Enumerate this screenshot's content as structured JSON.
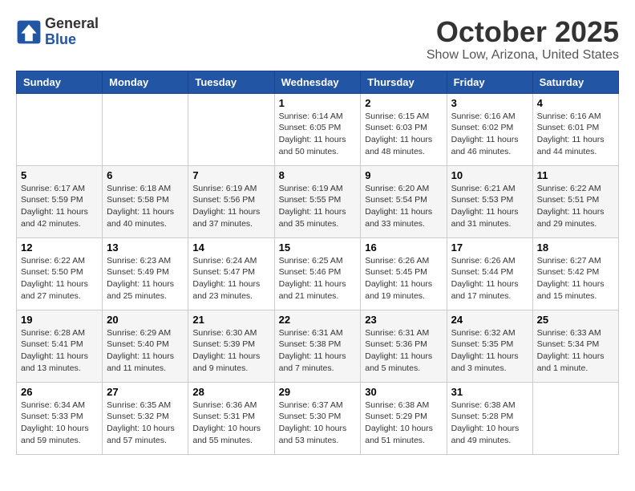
{
  "logo": {
    "line1": "General",
    "line2": "Blue"
  },
  "title": "October 2025",
  "subtitle": "Show Low, Arizona, United States",
  "days_of_week": [
    "Sunday",
    "Monday",
    "Tuesday",
    "Wednesday",
    "Thursday",
    "Friday",
    "Saturday"
  ],
  "weeks": [
    [
      {
        "day": "",
        "info": ""
      },
      {
        "day": "",
        "info": ""
      },
      {
        "day": "",
        "info": ""
      },
      {
        "day": "1",
        "info": "Sunrise: 6:14 AM\nSunset: 6:05 PM\nDaylight: 11 hours\nand 50 minutes."
      },
      {
        "day": "2",
        "info": "Sunrise: 6:15 AM\nSunset: 6:03 PM\nDaylight: 11 hours\nand 48 minutes."
      },
      {
        "day": "3",
        "info": "Sunrise: 6:16 AM\nSunset: 6:02 PM\nDaylight: 11 hours\nand 46 minutes."
      },
      {
        "day": "4",
        "info": "Sunrise: 6:16 AM\nSunset: 6:01 PM\nDaylight: 11 hours\nand 44 minutes."
      }
    ],
    [
      {
        "day": "5",
        "info": "Sunrise: 6:17 AM\nSunset: 5:59 PM\nDaylight: 11 hours\nand 42 minutes."
      },
      {
        "day": "6",
        "info": "Sunrise: 6:18 AM\nSunset: 5:58 PM\nDaylight: 11 hours\nand 40 minutes."
      },
      {
        "day": "7",
        "info": "Sunrise: 6:19 AM\nSunset: 5:56 PM\nDaylight: 11 hours\nand 37 minutes."
      },
      {
        "day": "8",
        "info": "Sunrise: 6:19 AM\nSunset: 5:55 PM\nDaylight: 11 hours\nand 35 minutes."
      },
      {
        "day": "9",
        "info": "Sunrise: 6:20 AM\nSunset: 5:54 PM\nDaylight: 11 hours\nand 33 minutes."
      },
      {
        "day": "10",
        "info": "Sunrise: 6:21 AM\nSunset: 5:53 PM\nDaylight: 11 hours\nand 31 minutes."
      },
      {
        "day": "11",
        "info": "Sunrise: 6:22 AM\nSunset: 5:51 PM\nDaylight: 11 hours\nand 29 minutes."
      }
    ],
    [
      {
        "day": "12",
        "info": "Sunrise: 6:22 AM\nSunset: 5:50 PM\nDaylight: 11 hours\nand 27 minutes."
      },
      {
        "day": "13",
        "info": "Sunrise: 6:23 AM\nSunset: 5:49 PM\nDaylight: 11 hours\nand 25 minutes."
      },
      {
        "day": "14",
        "info": "Sunrise: 6:24 AM\nSunset: 5:47 PM\nDaylight: 11 hours\nand 23 minutes."
      },
      {
        "day": "15",
        "info": "Sunrise: 6:25 AM\nSunset: 5:46 PM\nDaylight: 11 hours\nand 21 minutes."
      },
      {
        "day": "16",
        "info": "Sunrise: 6:26 AM\nSunset: 5:45 PM\nDaylight: 11 hours\nand 19 minutes."
      },
      {
        "day": "17",
        "info": "Sunrise: 6:26 AM\nSunset: 5:44 PM\nDaylight: 11 hours\nand 17 minutes."
      },
      {
        "day": "18",
        "info": "Sunrise: 6:27 AM\nSunset: 5:42 PM\nDaylight: 11 hours\nand 15 minutes."
      }
    ],
    [
      {
        "day": "19",
        "info": "Sunrise: 6:28 AM\nSunset: 5:41 PM\nDaylight: 11 hours\nand 13 minutes."
      },
      {
        "day": "20",
        "info": "Sunrise: 6:29 AM\nSunset: 5:40 PM\nDaylight: 11 hours\nand 11 minutes."
      },
      {
        "day": "21",
        "info": "Sunrise: 6:30 AM\nSunset: 5:39 PM\nDaylight: 11 hours\nand 9 minutes."
      },
      {
        "day": "22",
        "info": "Sunrise: 6:31 AM\nSunset: 5:38 PM\nDaylight: 11 hours\nand 7 minutes."
      },
      {
        "day": "23",
        "info": "Sunrise: 6:31 AM\nSunset: 5:36 PM\nDaylight: 11 hours\nand 5 minutes."
      },
      {
        "day": "24",
        "info": "Sunrise: 6:32 AM\nSunset: 5:35 PM\nDaylight: 11 hours\nand 3 minutes."
      },
      {
        "day": "25",
        "info": "Sunrise: 6:33 AM\nSunset: 5:34 PM\nDaylight: 11 hours\nand 1 minute."
      }
    ],
    [
      {
        "day": "26",
        "info": "Sunrise: 6:34 AM\nSunset: 5:33 PM\nDaylight: 10 hours\nand 59 minutes."
      },
      {
        "day": "27",
        "info": "Sunrise: 6:35 AM\nSunset: 5:32 PM\nDaylight: 10 hours\nand 57 minutes."
      },
      {
        "day": "28",
        "info": "Sunrise: 6:36 AM\nSunset: 5:31 PM\nDaylight: 10 hours\nand 55 minutes."
      },
      {
        "day": "29",
        "info": "Sunrise: 6:37 AM\nSunset: 5:30 PM\nDaylight: 10 hours\nand 53 minutes."
      },
      {
        "day": "30",
        "info": "Sunrise: 6:38 AM\nSunset: 5:29 PM\nDaylight: 10 hours\nand 51 minutes."
      },
      {
        "day": "31",
        "info": "Sunrise: 6:38 AM\nSunset: 5:28 PM\nDaylight: 10 hours\nand 49 minutes."
      },
      {
        "day": "",
        "info": ""
      }
    ]
  ]
}
